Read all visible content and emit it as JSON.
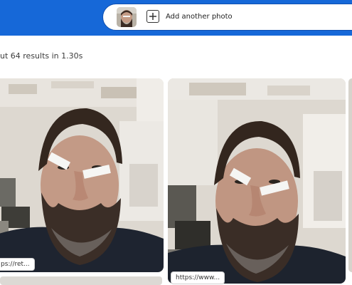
{
  "search": {
    "add_label": "Add another photo"
  },
  "results": {
    "count_text": "ut 64 results in 1.30s"
  },
  "cards": [
    {
      "url": "ps://ret..."
    },
    {
      "url": "https://www..."
    }
  ],
  "icons": {
    "add": "plus-square-icon",
    "thumbnail": "query-photo-thumbnail"
  },
  "colors": {
    "header": "#1668d8",
    "pill_border": "#0f4fb0"
  }
}
